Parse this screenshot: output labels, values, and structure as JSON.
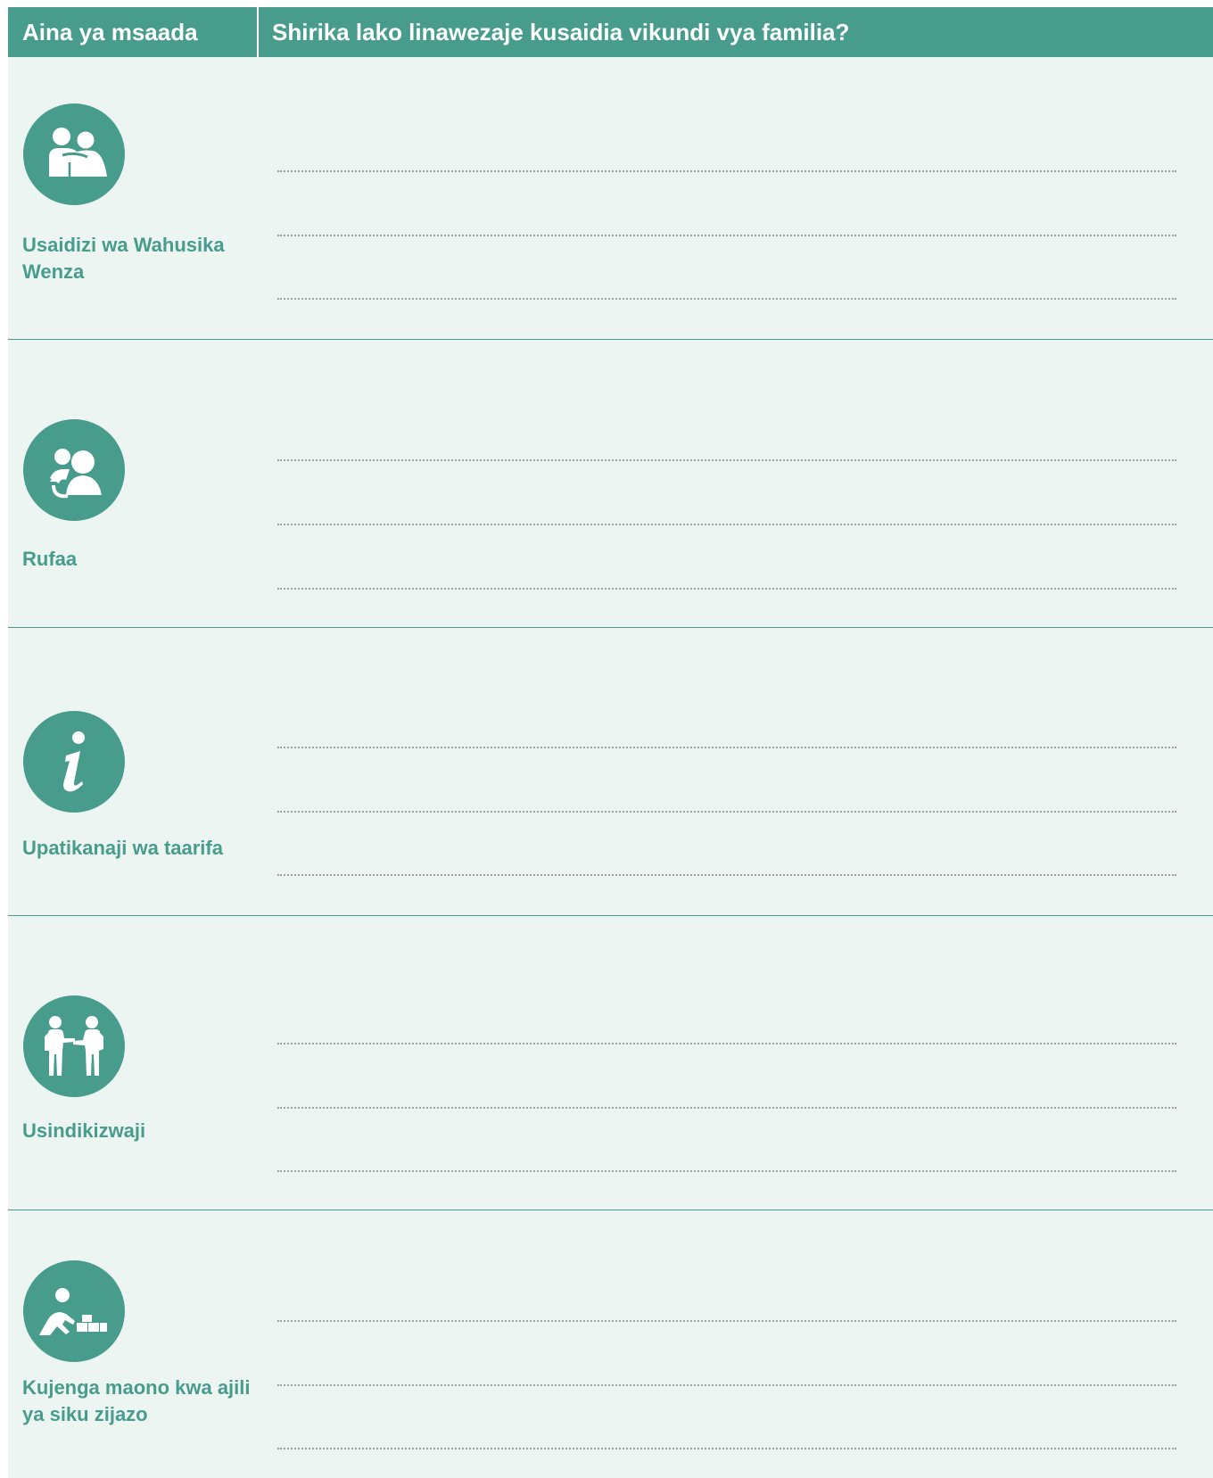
{
  "header": {
    "col1": "Aina ya msaada",
    "col2": "Shirika lako linawezaje kusaidia vikundi vya familia?"
  },
  "rows": [
    {
      "icon": "peer-support-icon",
      "label": "Usaidizi wa Wahusika Wenza"
    },
    {
      "icon": "referral-icon",
      "label": "Rufaa"
    },
    {
      "icon": "information-icon",
      "label": "Upatikanaji wa taarifa"
    },
    {
      "icon": "accompaniment-icon",
      "label": "Usindikizwaji"
    },
    {
      "icon": "future-building-icon",
      "label": "Kujenga maono kwa ajili ya siku zijazo"
    }
  ],
  "colors": {
    "header_bg": "#479c8c",
    "row_bg": "#edf5f3",
    "label_text": "#479c8c",
    "dots": "#9aa3a1"
  }
}
